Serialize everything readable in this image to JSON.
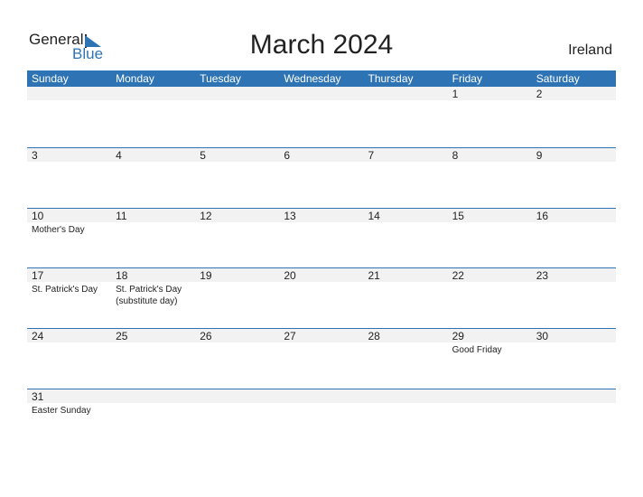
{
  "logo": {
    "line1": "General",
    "line2": "Blue"
  },
  "title": "March 2024",
  "country": "Ireland",
  "weekdays": [
    "Sunday",
    "Monday",
    "Tuesday",
    "Wednesday",
    "Thursday",
    "Friday",
    "Saturday"
  ],
  "weeks": [
    [
      {
        "d": ""
      },
      {
        "d": ""
      },
      {
        "d": ""
      },
      {
        "d": ""
      },
      {
        "d": ""
      },
      {
        "d": "1"
      },
      {
        "d": "2"
      }
    ],
    [
      {
        "d": "3"
      },
      {
        "d": "4"
      },
      {
        "d": "5"
      },
      {
        "d": "6"
      },
      {
        "d": "7"
      },
      {
        "d": "8"
      },
      {
        "d": "9"
      }
    ],
    [
      {
        "d": "10",
        "h": "Mother's Day"
      },
      {
        "d": "11"
      },
      {
        "d": "12"
      },
      {
        "d": "13"
      },
      {
        "d": "14"
      },
      {
        "d": "15"
      },
      {
        "d": "16"
      }
    ],
    [
      {
        "d": "17",
        "h": "St. Patrick's Day"
      },
      {
        "d": "18",
        "h": "St. Patrick's Day",
        "h2": "(substitute day)"
      },
      {
        "d": "19"
      },
      {
        "d": "20"
      },
      {
        "d": "21"
      },
      {
        "d": "22"
      },
      {
        "d": "23"
      }
    ],
    [
      {
        "d": "24"
      },
      {
        "d": "25"
      },
      {
        "d": "26"
      },
      {
        "d": "27"
      },
      {
        "d": "28"
      },
      {
        "d": "29",
        "h": "Good Friday"
      },
      {
        "d": "30"
      }
    ],
    [
      {
        "d": "31",
        "h": "Easter Sunday"
      },
      {
        "d": ""
      },
      {
        "d": ""
      },
      {
        "d": ""
      },
      {
        "d": ""
      },
      {
        "d": ""
      },
      {
        "d": ""
      }
    ]
  ],
  "colors": {
    "accent": "#2e74b5",
    "band": "#f2f2f2"
  }
}
